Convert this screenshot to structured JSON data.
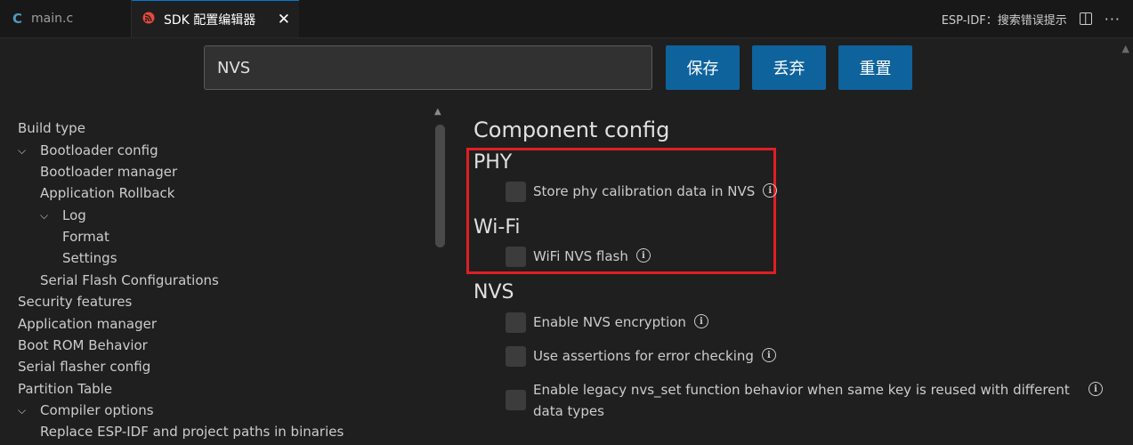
{
  "tabs": [
    {
      "label": "main.c",
      "icon": "c-file-icon"
    },
    {
      "label": "SDK 配置编辑器",
      "icon": "espressif-logo-icon",
      "close": "✕"
    }
  ],
  "status": {
    "hint": "ESP-IDF：搜索错误提示",
    "more": "···"
  },
  "search": {
    "value": "NVS"
  },
  "buttons": {
    "save": "保存",
    "discard": "丢弃",
    "reset": "重置"
  },
  "sidebar": [
    {
      "label": "Build type",
      "level": 0,
      "expanded": null
    },
    {
      "label": "Bootloader config",
      "level": 0,
      "expanded": true
    },
    {
      "label": "Bootloader manager",
      "level": 1,
      "expanded": null
    },
    {
      "label": "Application Rollback",
      "level": 1,
      "expanded": null
    },
    {
      "label": "Log",
      "level": 1,
      "expanded": true
    },
    {
      "label": "Format",
      "level": 2,
      "expanded": null
    },
    {
      "label": "Settings",
      "level": 2,
      "expanded": null
    },
    {
      "label": "Serial Flash Configurations",
      "level": 1,
      "expanded": null
    },
    {
      "label": "Security features",
      "level": 0,
      "expanded": null
    },
    {
      "label": "Application manager",
      "level": 0,
      "expanded": null
    },
    {
      "label": "Boot ROM Behavior",
      "level": 0,
      "expanded": null
    },
    {
      "label": "Serial flasher config",
      "level": 0,
      "expanded": null
    },
    {
      "label": "Partition Table",
      "level": 0,
      "expanded": null
    },
    {
      "label": "Compiler options",
      "level": 0,
      "expanded": true
    },
    {
      "label": "Replace ESP-IDF and project paths in binaries",
      "level": 1,
      "expanded": null
    }
  ],
  "main": {
    "heading": "Component config",
    "sections": [
      {
        "title": "PHY",
        "options": [
          {
            "label": "Store phy calibration data in NVS",
            "checked": false
          }
        ]
      },
      {
        "title": "Wi-Fi",
        "options": [
          {
            "label": "WiFi NVS flash",
            "checked": false
          }
        ]
      },
      {
        "title": "NVS",
        "options": [
          {
            "label": "Enable NVS encryption",
            "checked": false
          },
          {
            "label": "Use assertions for error checking",
            "checked": false
          },
          {
            "label": "Enable legacy nvs_set function behavior when same key is reused with different data types",
            "checked": false
          }
        ]
      }
    ]
  },
  "colors": {
    "accent": "#0e639c",
    "highlight": "#e01e24",
    "background": "#1f1f1f"
  }
}
